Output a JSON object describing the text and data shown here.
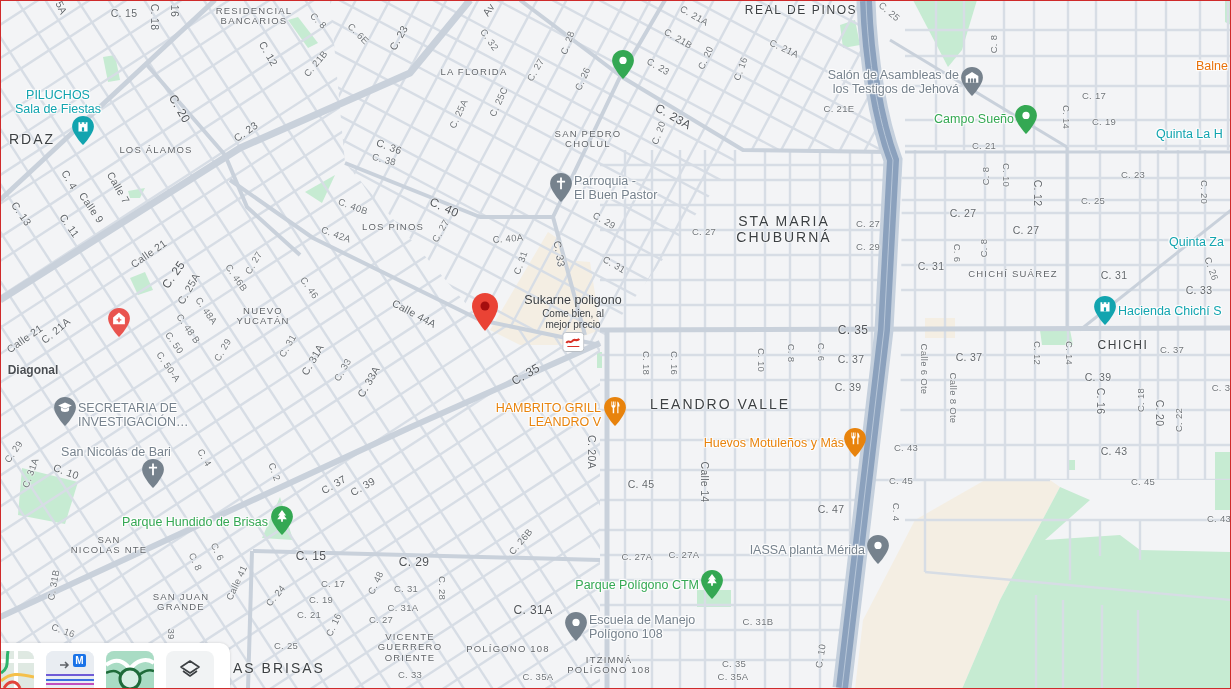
{
  "map": {
    "area_labels": [
      {
        "lines": [
          "RESIDENCIAL",
          "BANCARIOS"
        ]
      },
      {
        "lines": [
          "REAL DE PINOS"
        ]
      },
      {
        "lines": [
          "LA FLORIDA"
        ]
      },
      {
        "lines": [
          "RDAZ"
        ]
      },
      {
        "lines": [
          "LOS ÁLAMOS"
        ]
      },
      {
        "lines": [
          "SAN PEDRO",
          "CHOLUL"
        ]
      },
      {
        "lines": [
          "LOS PINOS"
        ]
      },
      {
        "lines": [
          "STA MARIA",
          "CHUBURNÁ"
        ]
      },
      {
        "lines": [
          "CHICHÍ SUÁREZ"
        ]
      },
      {
        "lines": [
          "NUEVO",
          "YUCATÁN"
        ]
      },
      {
        "lines": [
          "CHICHI"
        ]
      },
      {
        "lines": [
          "LEANDRO VALLE"
        ]
      },
      {
        "lines": [
          "SAN",
          "NICOLAS NTE"
        ]
      },
      {
        "lines": [
          "SAN JUAN",
          "GRANDE"
        ]
      },
      {
        "lines": [
          "VICENTE",
          "GUERRERO",
          "ORIENTE"
        ]
      },
      {
        "lines": [
          "POLÍGONO 108"
        ]
      },
      {
        "lines": [
          "AS BRISAS"
        ]
      },
      {
        "lines": [
          "ITZIMNÁ",
          "POLÍGONO 108"
        ]
      }
    ],
    "street_labels": [
      "5A",
      "C. 15",
      "C. 18",
      "16",
      "C. 8",
      "Av",
      "C. 6E",
      "C. 21A",
      "C. 25",
      "C. 12",
      "C. 21B",
      "C. 23",
      "C. 32",
      "C. 28",
      "C. 21B",
      "C. 20",
      "C. 21A",
      "C. 8",
      "C. 27",
      "C. 26",
      "C. 23",
      "C. 16",
      "C. 20",
      "C. 25A",
      "C. 25C",
      "C. 17",
      "C. 23A",
      "C. 21E",
      "C. 23",
      "C. 20",
      "C. 14",
      "C. 19",
      "C. 36",
      "C. 21",
      "C. 38",
      "C. 4",
      "Calle 7",
      "C. 8",
      "C. 10",
      "C. 23",
      "C. 13",
      "Calle 9",
      "C. 40B",
      "C. 40",
      "C. 12",
      "C. 25",
      "C. 20",
      "C. 11",
      "C. 27",
      "C. 29",
      "C. 27",
      "C. 27",
      "C. 42A",
      "C. 40A",
      "C. 27",
      "C. 27",
      "Calle 21",
      "C. 27",
      "C. 31",
      "C. 33",
      "C. 29",
      "C. 31",
      "C. 6",
      "C. 8",
      "C. 25",
      "C. 25A",
      "C. 46B",
      "C. 31",
      "C. 46",
      "C. 31",
      "C. 26",
      "C. 48A",
      "C. 33",
      "Calle 21",
      "C. 21A",
      "C. 48 B",
      "Calle 44A",
      "C. 50",
      "C. 29",
      "C. 31",
      "C. 35",
      "C. 50-A",
      "C. 31A",
      "C. 18",
      "C. 16",
      "C. 10",
      "C. 8",
      "C. 6",
      "C. 37",
      "Calle 6 Ote",
      "C. 37",
      "C. 12",
      "C. 14",
      "C. 37",
      "Diagonal",
      "C. 33",
      "C. 33A",
      "C. 35",
      "C. 39",
      "Calle 8 Ote",
      "C. 39",
      "C. 16",
      "C. 18",
      "C. 3",
      "C. 20",
      "C. 22",
      "C. 29",
      "C. 4",
      "C. 20A",
      "C. 43",
      "C. 31A",
      "C. 43",
      "C. 10",
      "C. 2",
      "C. 37",
      "C. 39",
      "C. 45",
      "Calle 14",
      "C. 45",
      "C. 45",
      "C. 47",
      "C. 4",
      "C. 43",
      "C. 8",
      "C. 6",
      "C. 15",
      "C. 29",
      "C. 26B",
      "C. 27A",
      "C. 27A",
      "C. 31B",
      "Calle 41",
      "C. 24",
      "C. 17",
      "C. 48",
      "C. 31",
      "C. 28",
      "C. 19",
      "C. 21",
      "C. 16",
      "C. 31A",
      "C. 27",
      "C. 31A",
      "C. 31B",
      "C. 16",
      "39",
      "C. 25",
      "C. 35",
      "C. 10",
      "C. 33",
      "C. 35A",
      "C. 35A"
    ],
    "places": [
      {
        "kind": "dot",
        "color": "#34a853"
      },
      {
        "name_lines": [
          "Salón de Asambleas de",
          "los Testigos de Jehová"
        ],
        "kind": "building",
        "color": "#76828d"
      },
      {
        "name_lines": [
          "Balne"
        ],
        "kind": "label",
        "color": "#e8710a"
      },
      {
        "name_lines": [
          "PILUCHOS",
          "Sala de Fiestas"
        ],
        "kind": "castle",
        "color": "#12a4af"
      },
      {
        "name_lines": [
          "Campo Sueño"
        ],
        "kind": "dot",
        "color": "#34a853"
      },
      {
        "name_lines": [
          "Quinta La H"
        ],
        "kind": "label",
        "color": "#12a4af"
      },
      {
        "name_lines": [
          "Parroquia -",
          "El Buen Pastor"
        ],
        "kind": "cross",
        "color": "#76828d"
      },
      {
        "name_lines": [
          "Quinta Za"
        ],
        "kind": "label",
        "color": "#12a4af"
      },
      {
        "kind": "clinic",
        "color": "#e9544f"
      },
      {
        "name_lines": [
          "Hacienda Chichí S"
        ],
        "kind": "castle",
        "color": "#12a4af"
      },
      {
        "name_lines": [
          "SECRETARIA DE",
          "INVESTIGACIÓN…"
        ],
        "kind": "cap",
        "color": "#76828d"
      },
      {
        "name_lines": [
          "HAMBRITO GRILL",
          "LEANDRO V"
        ],
        "kind": "fork_knife",
        "color": "#e8830c"
      },
      {
        "name_lines": [
          "San Nicolás de Bari"
        ],
        "kind": "cross",
        "color": "#76828d"
      },
      {
        "name_lines": [
          "Huevos Motuleños y Más"
        ],
        "kind": "fork_knife",
        "color": "#e8830c"
      },
      {
        "name_lines": [
          "Parque Hundido de Brisas"
        ],
        "kind": "tree",
        "color": "#34a853"
      },
      {
        "name_lines": [
          "IASSA planta Mérida"
        ],
        "kind": "dot",
        "color": "#76828d"
      },
      {
        "name_lines": [
          "Parque Polígono CTM"
        ],
        "kind": "tree",
        "color": "#34a853"
      },
      {
        "name_lines": [
          "Escuela de Manejo",
          "Polígono 108"
        ],
        "kind": "dot",
        "color": "#76828d"
      }
    ],
    "selected_place": {
      "name": "Sukarne poligono",
      "tagline_lines": [
        "Come bien, al",
        "mejor precio"
      ]
    }
  },
  "layers_panel": {
    "thumbnails": [
      {
        "kind": "traffic"
      },
      {
        "kind": "transit",
        "badge": "M"
      },
      {
        "kind": "biking"
      }
    ]
  }
}
